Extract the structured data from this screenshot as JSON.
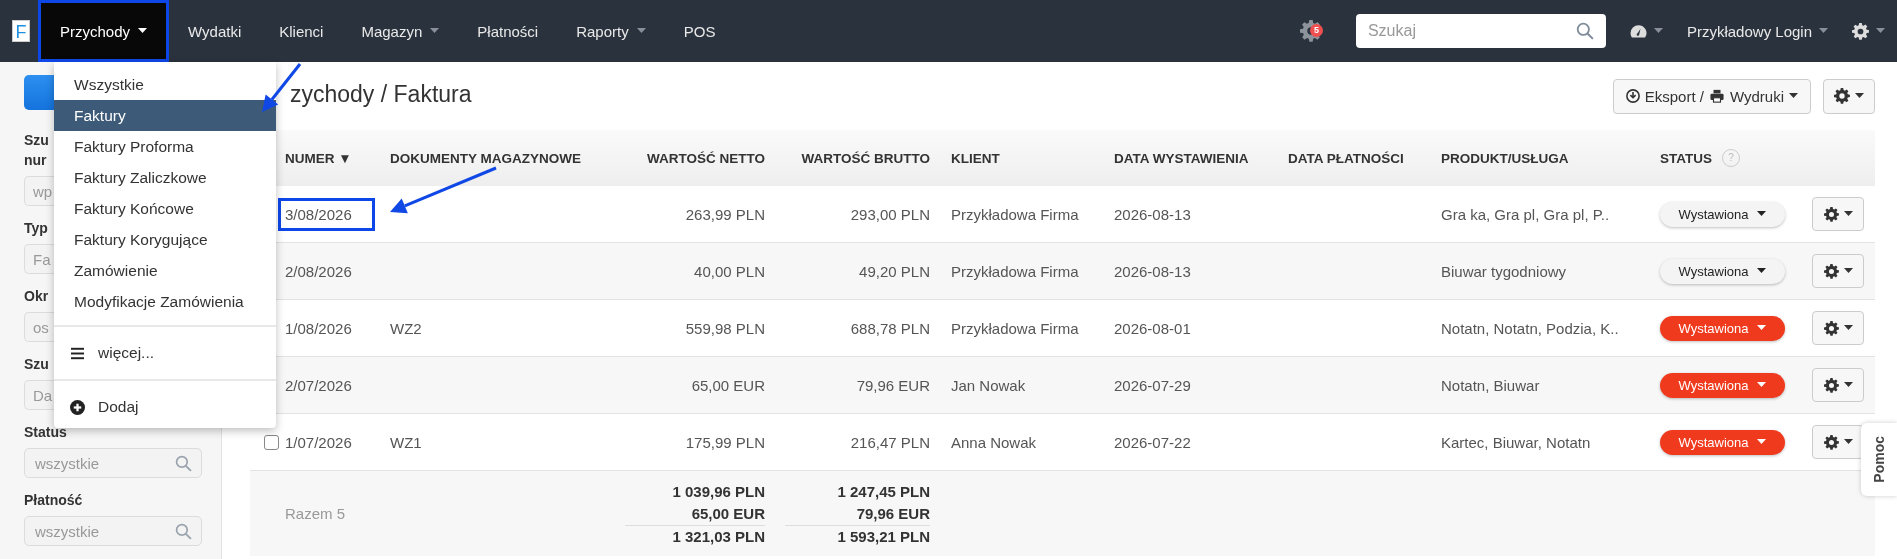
{
  "navbar": {
    "logo": "F",
    "items": [
      {
        "label": "Przychody",
        "selected": true,
        "dropdown": true,
        "highlighted": true
      },
      {
        "label": "Wydatki",
        "selected": false,
        "dropdown": false,
        "highlighted": false
      },
      {
        "label": "Klienci",
        "selected": false,
        "dropdown": false,
        "highlighted": false
      },
      {
        "label": "Magazyn",
        "selected": false,
        "dropdown": true,
        "highlighted": false
      },
      {
        "label": "Płatności",
        "selected": false,
        "dropdown": false,
        "highlighted": false
      },
      {
        "label": "Raporty",
        "selected": false,
        "dropdown": true,
        "highlighted": false
      },
      {
        "label": "POS",
        "selected": false,
        "dropdown": false,
        "highlighted": false
      }
    ],
    "notifications": {
      "count": "5"
    },
    "search": {
      "placeholder": "Szukaj"
    },
    "user": {
      "label": "Przykładowy Login"
    }
  },
  "dropdown_menu": {
    "items": [
      {
        "label": "Wszystkie",
        "selected": false,
        "highlighted": false
      },
      {
        "label": "Faktury",
        "selected": true,
        "highlighted": true
      },
      {
        "label": "Faktury Proforma",
        "selected": false,
        "highlighted": false
      },
      {
        "label": "Faktury Zaliczkowe",
        "selected": false,
        "highlighted": false
      },
      {
        "label": "Faktury Końcowe",
        "selected": false,
        "highlighted": false
      },
      {
        "label": "Faktury Korygujące",
        "selected": false,
        "highlighted": false
      },
      {
        "label": "Zamówienie",
        "selected": false,
        "highlighted": false
      },
      {
        "label": "Modyfikacje Zamówienia",
        "selected": false,
        "highlighted": false
      }
    ],
    "actions": [
      {
        "kind": "more",
        "label": "więcej..."
      },
      {
        "kind": "add",
        "label": "Dodaj"
      }
    ]
  },
  "sidebar": {
    "filters": [
      {
        "label_lines": [
          "Szu",
          "nur"
        ],
        "placeholder": "wp",
        "search": false
      },
      {
        "label_lines": [
          "Typ"
        ],
        "placeholder": "Fa",
        "search": false
      },
      {
        "label_lines": [
          "Okr"
        ],
        "placeholder": "os",
        "search": false
      },
      {
        "label_lines": [
          "Szu"
        ],
        "placeholder": "Da",
        "search": false
      },
      {
        "label_lines": [
          "Status"
        ],
        "placeholder": "wszystkie",
        "search": true
      },
      {
        "label_lines": [
          "Płatność"
        ],
        "placeholder": "wszystkie",
        "search": true
      }
    ]
  },
  "page": {
    "title": "zychody / Faktura",
    "export_button": {
      "label_1": "Eksport /",
      "label_2": "Wydruki"
    }
  },
  "table": {
    "columns": [
      {
        "label": "NUMER ▼"
      },
      {
        "label": "DOKUMENTY MAGAZYNOWE"
      },
      {
        "label": "WARTOŚĆ NETTO"
      },
      {
        "label": "WARTOŚĆ BRUTTO"
      },
      {
        "label": "KLIENT"
      },
      {
        "label": "DATA WYSTAWIENIA"
      },
      {
        "label": "DATA PŁATNOŚCI"
      },
      {
        "label": "PRODUKT/USŁUGA"
      },
      {
        "label": "STATUS",
        "help": "?"
      }
    ],
    "rows": [
      {
        "number": "3/08/2026",
        "highlighted": true,
        "net": "263,99 PLN",
        "gross": "293,00 PLN",
        "client": "Przykładowa Firma",
        "issue_date": "2026-08-13",
        "products": "Gra ka, Gra pl, Gra pl, P..",
        "status": {
          "label": "Wystawiona",
          "color": "#f4f4f4"
        }
      },
      {
        "number": "2/08/2026",
        "highlighted": false,
        "net": "40,00 PLN",
        "gross": "49,20 PLN",
        "client": "Przykładowa Firma",
        "issue_date": "2026-08-13",
        "products": "Biuwar tygodniowy",
        "status": {
          "label": "Wystawiona",
          "color": "#f4f4f4"
        }
      },
      {
        "number": "1/08/2026",
        "highlighted": false,
        "documents": "WZ2",
        "net": "559,98 PLN",
        "gross": "688,78 PLN",
        "client": "Przykładowa Firma",
        "issue_date": "2026-08-01",
        "products": "Notatn, Notatn, Podzia, K..",
        "status": {
          "label": "Wystawiona",
          "color": "#ef3a1d"
        }
      },
      {
        "number": "2/07/2026",
        "highlighted": false,
        "net": "65,00 EUR",
        "gross": "79,96 EUR",
        "client": "Jan Nowak",
        "issue_date": "2026-07-29",
        "products": "Notatn, Biuwar",
        "status": {
          "label": "Wystawiona",
          "color": "#ef3a1d"
        }
      },
      {
        "checkbox": {
          "checked": false
        },
        "number": "1/07/2026",
        "highlighted": false,
        "documents": "WZ1",
        "net": "175,99 PLN",
        "gross": "216,47 PLN",
        "client": "Anna Nowak",
        "issue_date": "2026-07-22",
        "products": "Kartec, Biuwar, Notatn",
        "status": {
          "label": "Wystawiona",
          "color": "#ef3a1d"
        }
      }
    ],
    "totals": {
      "label": "Razem 5",
      "net": [
        "1 039,96 PLN",
        "65,00 EUR",
        "1 321,03 PLN"
      ],
      "gross": [
        "1 247,45 PLN",
        "79,96 EUR",
        "1 593,21 PLN"
      ]
    }
  },
  "help_tab": {
    "label": "Pomoc"
  }
}
